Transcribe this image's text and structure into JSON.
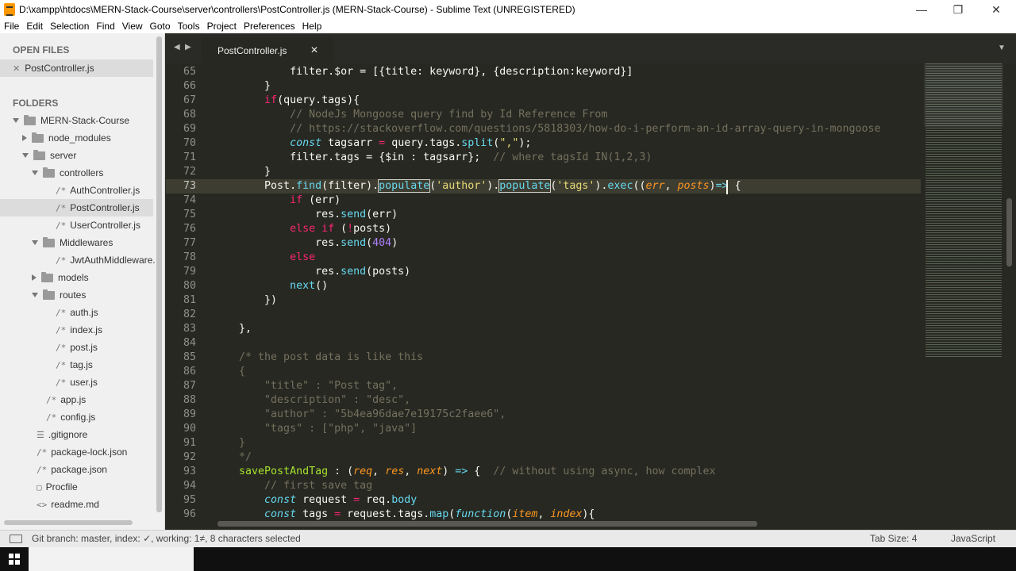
{
  "window": {
    "title": "D:\\xampp\\htdocs\\MERN-Stack-Course\\server\\controllers\\PostController.js (MERN-Stack-Course) - Sublime Text (UNREGISTERED)",
    "minimize_icon": "minimize-icon",
    "maximize_icon": "restore-icon",
    "close_icon": "close-icon"
  },
  "menu": [
    "File",
    "Edit",
    "Selection",
    "Find",
    "View",
    "Goto",
    "Tools",
    "Project",
    "Preferences",
    "Help"
  ],
  "sidebar": {
    "open_files_heading": "OPEN FILES",
    "open_file": "PostController.js",
    "folders_heading": "FOLDERS",
    "tree": [
      {
        "label": "MERN-Stack-Course",
        "kind": "folder",
        "depth": 0,
        "open": true
      },
      {
        "label": "node_modules",
        "kind": "folder",
        "depth": 1,
        "open": false
      },
      {
        "label": "server",
        "kind": "folder",
        "depth": 1,
        "open": true
      },
      {
        "label": "controllers",
        "kind": "folder",
        "depth": 2,
        "open": true
      },
      {
        "label": "AuthController.js",
        "kind": "file",
        "depth": 3
      },
      {
        "label": "PostController.js",
        "kind": "file",
        "depth": 3,
        "selected": true
      },
      {
        "label": "UserController.js",
        "kind": "file",
        "depth": 3
      },
      {
        "label": "Middlewares",
        "kind": "folder",
        "depth": 2,
        "open": true
      },
      {
        "label": "JwtAuthMiddleware.",
        "kind": "file",
        "depth": 3
      },
      {
        "label": "models",
        "kind": "folder",
        "depth": 2,
        "open": false
      },
      {
        "label": "routes",
        "kind": "folder",
        "depth": 2,
        "open": true
      },
      {
        "label": "auth.js",
        "kind": "file",
        "depth": 3
      },
      {
        "label": "index.js",
        "kind": "file",
        "depth": 3
      },
      {
        "label": "post.js",
        "kind": "file",
        "depth": 3
      },
      {
        "label": "tag.js",
        "kind": "file",
        "depth": 3
      },
      {
        "label": "user.js",
        "kind": "file",
        "depth": 3
      },
      {
        "label": "app.js",
        "kind": "file",
        "depth": 2
      },
      {
        "label": "config.js",
        "kind": "file",
        "depth": 2
      },
      {
        "label": ".gitignore",
        "kind": "file",
        "depth": 1,
        "glyph": "☰"
      },
      {
        "label": "package-lock.json",
        "kind": "file",
        "depth": 1
      },
      {
        "label": "package.json",
        "kind": "file",
        "depth": 1
      },
      {
        "label": "Procfile",
        "kind": "file",
        "depth": 1,
        "glyph": "▢"
      },
      {
        "label": "readme.md",
        "kind": "file",
        "depth": 1,
        "glyph": "<>"
      }
    ]
  },
  "tab": {
    "label": "PostController.js",
    "close_glyph": "✕",
    "nav_left": "◀",
    "nav_right": "▶",
    "dropdown": "▼"
  },
  "editor": {
    "active_line": 73,
    "lines": [
      {
        "n": "65",
        "tokens": [
          [
            "p",
            "            filter.$or = [{title: keyword}, {description:keyword}]"
          ]
        ]
      },
      {
        "n": "66",
        "tokens": [
          [
            "p",
            "        }"
          ]
        ]
      },
      {
        "n": "67",
        "tokens": [
          [
            "p",
            "        "
          ],
          [
            "k",
            "if"
          ],
          [
            "p",
            "(query.tags){"
          ]
        ]
      },
      {
        "n": "68",
        "tokens": [
          [
            "c",
            "            // NodeJs Mongoose query find by Id Reference From"
          ]
        ]
      },
      {
        "n": "69",
        "tokens": [
          [
            "c",
            "            // https://stackoverflow.com/questions/5818303/how-do-i-perform-an-id-array-query-in-mongoose"
          ]
        ]
      },
      {
        "n": "70",
        "tokens": [
          [
            "p",
            "            "
          ],
          [
            "st",
            "const"
          ],
          [
            "p",
            " tagsarr "
          ],
          [
            "k",
            "="
          ],
          [
            "p",
            " query.tags."
          ],
          [
            "f",
            "split"
          ],
          [
            "p",
            "("
          ],
          [
            "s",
            "\",\""
          ],
          [
            "p",
            ");"
          ]
        ]
      },
      {
        "n": "71",
        "tokens": [
          [
            "p",
            "            filter.tags = {$in : tagsarr};  "
          ],
          [
            "c",
            "// where tagsId IN(1,2,3)"
          ]
        ]
      },
      {
        "n": "72",
        "tokens": [
          [
            "p",
            "        }"
          ]
        ]
      },
      {
        "n": "73",
        "tokens": [
          [
            "p",
            "        Post."
          ],
          [
            "f",
            "find"
          ],
          [
            "p",
            "(filter)."
          ],
          [
            "hl",
            "populate"
          ],
          [
            "p",
            "("
          ],
          [
            "s",
            "'author'"
          ],
          [
            "p",
            ")."
          ],
          [
            "hl",
            "populate"
          ],
          [
            "p",
            "("
          ],
          [
            "s",
            "'tags'"
          ],
          [
            "p",
            ")."
          ],
          [
            "f",
            "exec"
          ],
          [
            "p",
            "(("
          ],
          [
            "pa",
            "err"
          ],
          [
            "p",
            ", "
          ],
          [
            "pa",
            "posts"
          ],
          [
            "p",
            ")"
          ],
          [
            "st",
            "=>"
          ],
          [
            "p",
            " {"
          ]
        ]
      },
      {
        "n": "74",
        "tokens": [
          [
            "p",
            "            "
          ],
          [
            "k",
            "if"
          ],
          [
            "p",
            " (err)"
          ]
        ]
      },
      {
        "n": "75",
        "tokens": [
          [
            "p",
            "                res."
          ],
          [
            "f",
            "send"
          ],
          [
            "p",
            "(err)"
          ]
        ]
      },
      {
        "n": "76",
        "tokens": [
          [
            "p",
            "            "
          ],
          [
            "k",
            "else if"
          ],
          [
            "p",
            " ("
          ],
          [
            "k",
            "!"
          ],
          [
            "p",
            "posts)"
          ]
        ]
      },
      {
        "n": "77",
        "tokens": [
          [
            "p",
            "                res."
          ],
          [
            "f",
            "send"
          ],
          [
            "p",
            "("
          ],
          [
            "n",
            "404"
          ],
          [
            "p",
            ")"
          ]
        ]
      },
      {
        "n": "78",
        "tokens": [
          [
            "p",
            "            "
          ],
          [
            "k",
            "else"
          ]
        ]
      },
      {
        "n": "79",
        "tokens": [
          [
            "p",
            "                res."
          ],
          [
            "f",
            "send"
          ],
          [
            "p",
            "(posts)"
          ]
        ]
      },
      {
        "n": "80",
        "tokens": [
          [
            "p",
            "            "
          ],
          [
            "f",
            "next"
          ],
          [
            "p",
            "()"
          ]
        ]
      },
      {
        "n": "81",
        "tokens": [
          [
            "p",
            "        })"
          ]
        ]
      },
      {
        "n": "82",
        "tokens": []
      },
      {
        "n": "83",
        "tokens": [
          [
            "p",
            "    },"
          ]
        ]
      },
      {
        "n": "84",
        "tokens": []
      },
      {
        "n": "85",
        "tokens": [
          [
            "c",
            "    /* the post data is like this"
          ]
        ]
      },
      {
        "n": "86",
        "tokens": [
          [
            "c",
            "    {"
          ]
        ]
      },
      {
        "n": "87",
        "tokens": [
          [
            "c",
            "        \"title\" : \"Post tag\","
          ]
        ]
      },
      {
        "n": "88",
        "tokens": [
          [
            "c",
            "        \"description\" : \"desc\","
          ]
        ]
      },
      {
        "n": "89",
        "tokens": [
          [
            "c",
            "        \"author\" : \"5b4ea96dae7e19175c2faee6\","
          ]
        ]
      },
      {
        "n": "90",
        "tokens": [
          [
            "c",
            "        \"tags\" : [\"php\", \"java\"]"
          ]
        ]
      },
      {
        "n": "91",
        "tokens": [
          [
            "c",
            "    }"
          ]
        ]
      },
      {
        "n": "92",
        "tokens": [
          [
            "c",
            "    */"
          ]
        ]
      },
      {
        "n": "93",
        "tokens": [
          [
            "p",
            "    "
          ],
          [
            "g",
            "savePostAndTag"
          ],
          [
            "p",
            " : ("
          ],
          [
            "pa",
            "req"
          ],
          [
            "p",
            ", "
          ],
          [
            "pa",
            "res"
          ],
          [
            "p",
            ", "
          ],
          [
            "pa",
            "next"
          ],
          [
            "p",
            ") "
          ],
          [
            "st",
            "=>"
          ],
          [
            "p",
            " {  "
          ],
          [
            "c",
            "// without using async, how complex"
          ]
        ]
      },
      {
        "n": "94",
        "tokens": [
          [
            "c",
            "        // first save tag"
          ]
        ]
      },
      {
        "n": "95",
        "tokens": [
          [
            "p",
            "        "
          ],
          [
            "st",
            "const"
          ],
          [
            "p",
            " request "
          ],
          [
            "k",
            "="
          ],
          [
            "p",
            " req."
          ],
          [
            "f",
            "body"
          ]
        ]
      },
      {
        "n": "96",
        "tokens": [
          [
            "p",
            "        "
          ],
          [
            "st",
            "const"
          ],
          [
            "p",
            " tags "
          ],
          [
            "k",
            "="
          ],
          [
            "p",
            " request.tags."
          ],
          [
            "f",
            "map"
          ],
          [
            "p",
            "("
          ],
          [
            "st",
            "function"
          ],
          [
            "p",
            "("
          ],
          [
            "pa",
            "item"
          ],
          [
            "p",
            ", "
          ],
          [
            "pa",
            "index"
          ],
          [
            "p",
            "){"
          ]
        ]
      }
    ]
  },
  "statusbar": {
    "git": "Git branch: master, index: ✓, working: 1≠, 8 characters selected",
    "tab_size": "Tab Size: 4",
    "syntax": "JavaScript"
  },
  "colors": {
    "editor_bg": "#272822",
    "keyword": "#f92672",
    "string": "#e6db74",
    "comment": "#75715e",
    "function": "#66d9ef",
    "number": "#ae81ff",
    "entity": "#a6e22e",
    "param": "#fd971f"
  }
}
